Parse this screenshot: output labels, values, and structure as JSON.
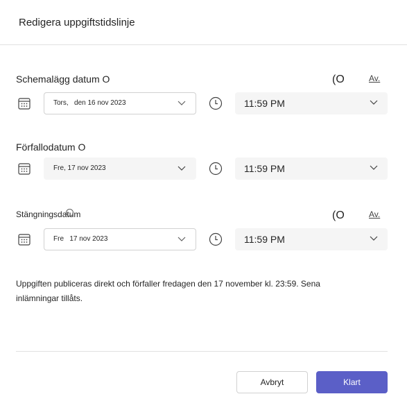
{
  "dialog": {
    "title": "Redigera uppgiftstidslinje"
  },
  "schedule": {
    "label": "Schemalägg datum O",
    "toggle_text": "(O",
    "av_label": "Av.",
    "date": "Tors,   den 16 nov 2023",
    "time": "11:59 PM"
  },
  "due": {
    "label": "Förfallodatum O",
    "date": "Fre, 17 nov 2023",
    "time": "11:59 PM"
  },
  "close": {
    "label": "Stängningsdatum",
    "toggle_text": "(O",
    "av_label": "Av.",
    "date": "Fre   17 nov 2023",
    "time": "11:59 PM"
  },
  "description": "Uppgiften publiceras direkt och förfaller fredagen den 17 november kl. 23:59. Sena inlämningar tillåts.",
  "buttons": {
    "cancel": "Avbryt",
    "done": "Klart"
  },
  "colors": {
    "primary": "#5b5fc7",
    "field_bg": "#f5f5f5",
    "border": "#d1d1d1",
    "text": "#242424"
  }
}
